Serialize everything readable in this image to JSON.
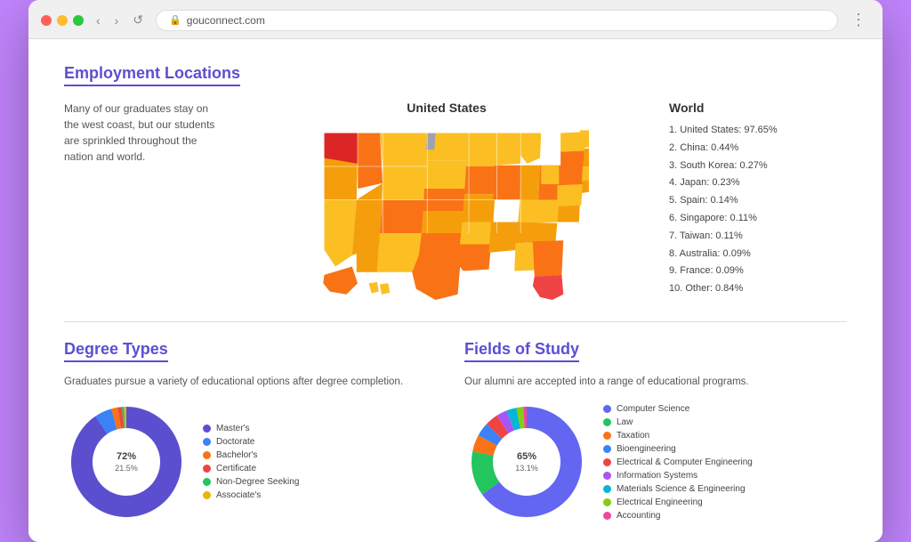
{
  "browser": {
    "url": "gouconnect.com",
    "back_label": "‹",
    "forward_label": "›",
    "refresh_label": "↺"
  },
  "employment": {
    "title": "Employment Locations",
    "description": "Many of our graduates stay on the west coast, but our students are sprinkled throughout the nation and world.",
    "map_title": "United States",
    "world_title": "World",
    "world_list": [
      "1. United States: 97.65%",
      "2. China: 0.44%",
      "3. South Korea: 0.27%",
      "4. Japan: 0.23%",
      "5. Spain: 0.14%",
      "6. Singapore: 0.11%",
      "7. Taiwan: 0.11%",
      "8. Australia: 0.09%",
      "9. France: 0.09%",
      "10. Other: 0.84%"
    ]
  },
  "degree_types": {
    "title": "Degree Types",
    "description": "Graduates pursue a variety of educational options after degree completion.",
    "segments": [
      {
        "label": "Master's",
        "percent": 72,
        "color": "#5b4fcf"
      },
      {
        "label": "Doctorate",
        "percent": 4,
        "color": "#3b82f6"
      },
      {
        "label": "Bachelor's",
        "percent": 1.5,
        "color": "#f97316"
      },
      {
        "label": "Certificate",
        "percent": 1,
        "color": "#ef4444"
      },
      {
        "label": "Non-Degree Seeking",
        "percent": 0.5,
        "color": "#22c55e"
      },
      {
        "label": "Associate's",
        "percent": 0.5,
        "color": "#eab308"
      }
    ],
    "center_labels": [
      "72%",
      "21.5%"
    ]
  },
  "fields_of_study": {
    "title": "Fields of Study",
    "description": "Our alumni are accepted into a range of educational programs.",
    "segments": [
      {
        "label": "Computer Science",
        "percent": 65,
        "color": "#6366f1"
      },
      {
        "label": "Law",
        "percent": 13.1,
        "color": "#22c55e"
      },
      {
        "label": "Taxation",
        "percent": 5,
        "color": "#f97316"
      },
      {
        "label": "Bioengineering",
        "percent": 4,
        "color": "#3b82f6"
      },
      {
        "label": "Electrical & Computer Engineering",
        "percent": 4,
        "color": "#ef4444"
      },
      {
        "label": "Information Systems",
        "percent": 3,
        "color": "#a855f7"
      },
      {
        "label": "Materials Science & Engineering",
        "percent": 3,
        "color": "#06b6d4"
      },
      {
        "label": "Electrical Engineering",
        "percent": 2,
        "color": "#84cc16"
      },
      {
        "label": "Accounting",
        "percent": 1,
        "color": "#ec4899"
      }
    ],
    "center_labels": [
      "65%",
      "13.1%"
    ]
  }
}
